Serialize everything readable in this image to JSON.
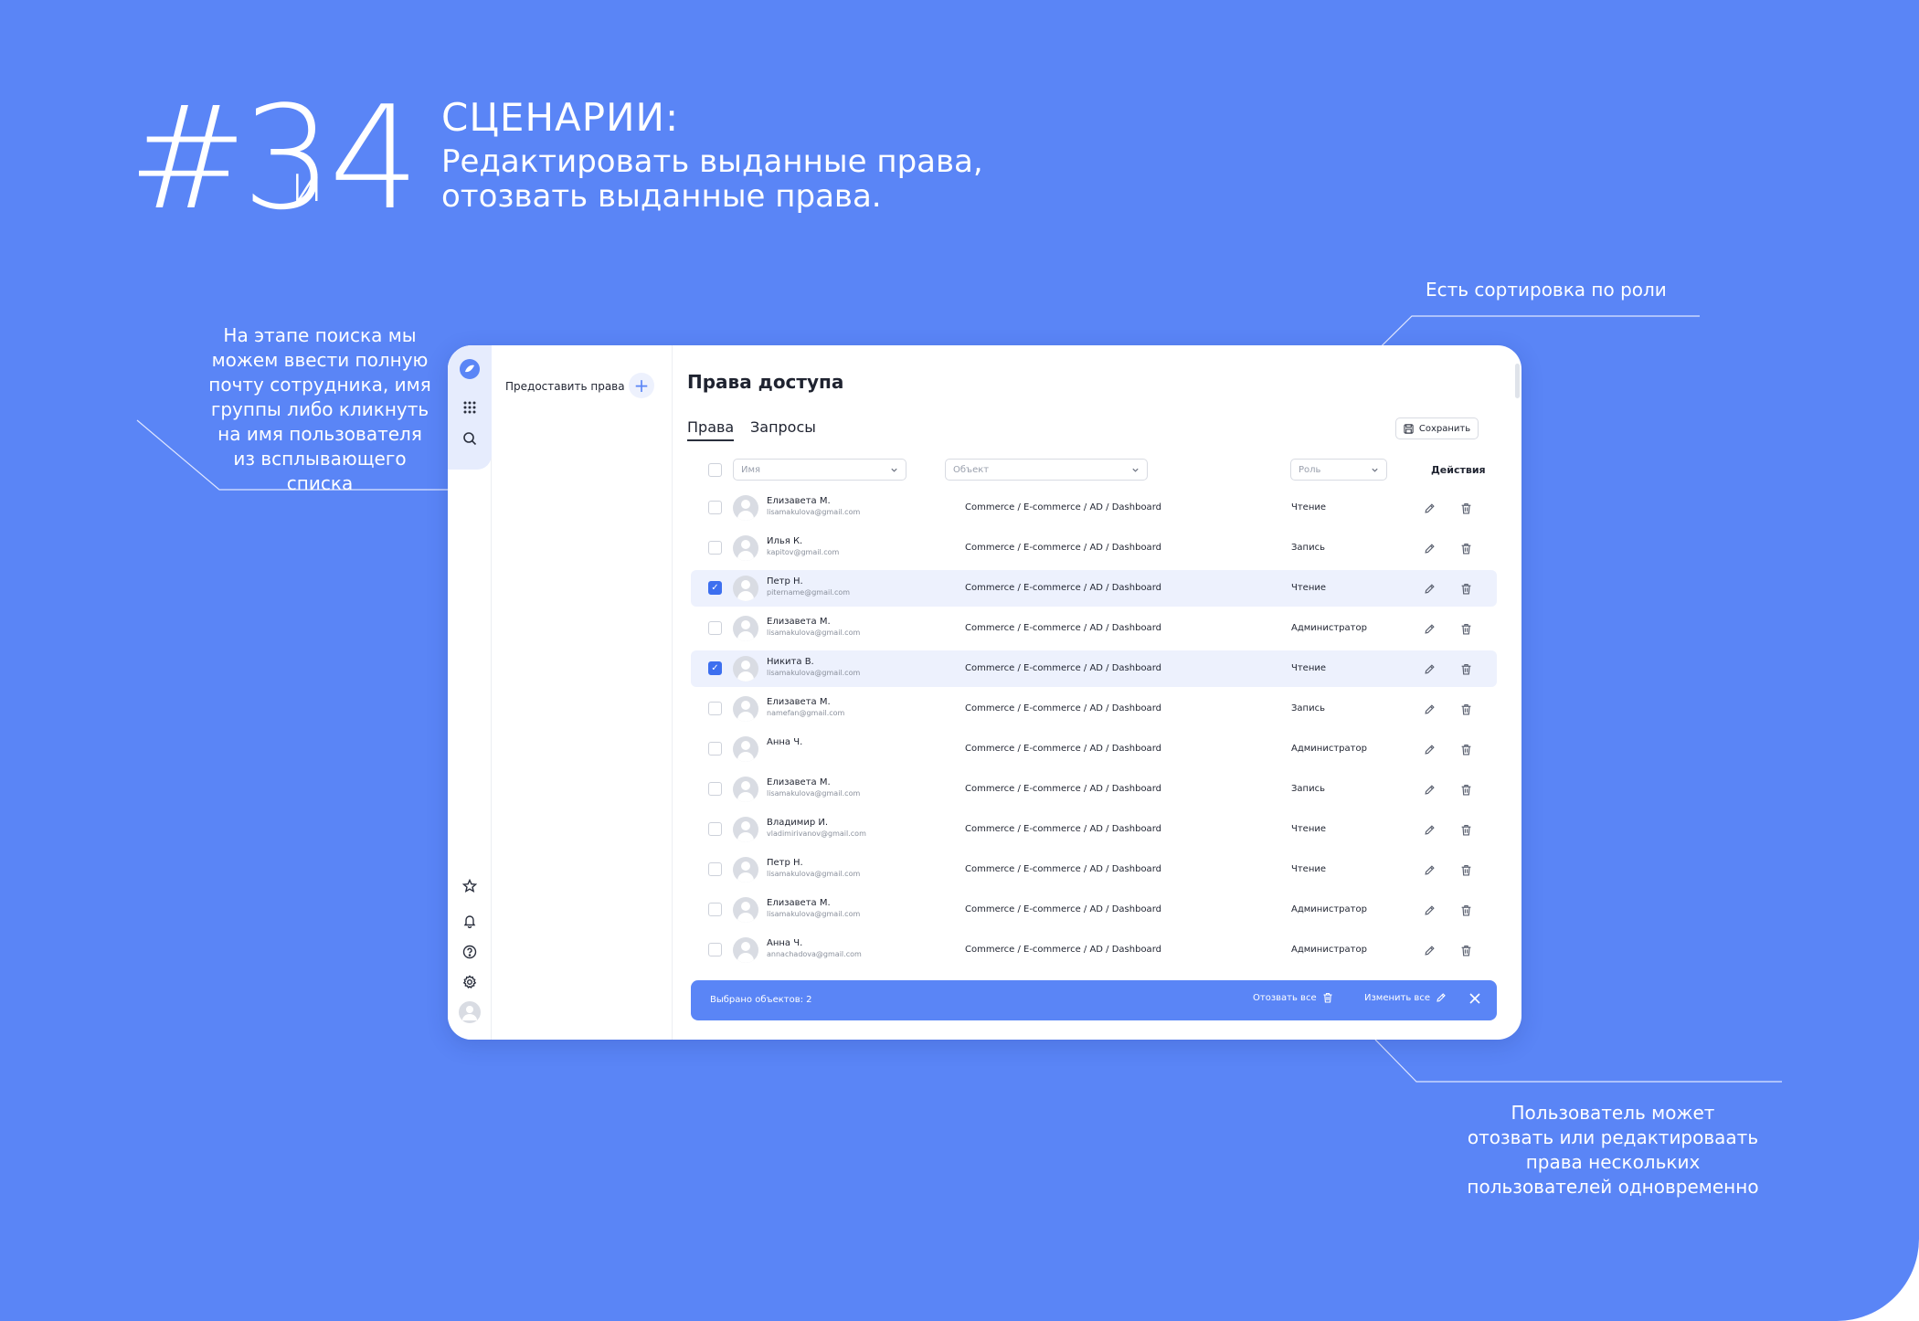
{
  "header": {
    "num_a": "#3",
    "conj": "и",
    "num_b": "4",
    "title": "СЦЕНАРИИ:",
    "subtitle_line1": "Редактировать выданные права,",
    "subtitle_line2": "отозвать выданные права."
  },
  "notes": {
    "search_tip": "На этапе поиска мы можем ввести полную почту сотрудника, имя группы либо кликнуть на имя пользователя из всплывающего списка",
    "sort_tip": "Есть сортировка по роли",
    "bulk_tip": "Пользователь может отозвать или редактироваать права нескольких пользователей одновременно"
  },
  "side_panel": {
    "grant_label": "Предоставить права",
    "grant_button": "+"
  },
  "main": {
    "title": "Права доступа",
    "tabs": [
      "Права",
      "Запросы"
    ],
    "save_label": "Сохранить",
    "filters": {
      "name": "Имя",
      "object": "Объект",
      "role": "Роль"
    },
    "actions_header": "Действия"
  },
  "rows": [
    {
      "name": "Елизавета М.",
      "email": "lisamakulova@gmail.com",
      "object": "Commerce / E-commerce / AD / Dashboard",
      "role": "Чтение",
      "selected": false
    },
    {
      "name": "Илья К.",
      "email": "kapitov@gmail.com",
      "object": "Commerce / E-commerce / AD / Dashboard",
      "role": "Запись",
      "selected": false
    },
    {
      "name": "Петр Н.",
      "email": "pitername@gmail.com",
      "object": "Commerce / E-commerce / AD / Dashboard",
      "role": "Чтение",
      "selected": true
    },
    {
      "name": "Елизавета М.",
      "email": "lisamakulova@gmail.com",
      "object": "Commerce / E-commerce / AD / Dashboard",
      "role": "Администратор",
      "selected": false
    },
    {
      "name": "Никита В.",
      "email": "lisamakulova@gmail.com",
      "object": "Commerce / E-commerce / AD / Dashboard",
      "role": "Чтение",
      "selected": true
    },
    {
      "name": "Елизавета М.",
      "email": "namefan@gmail.com",
      "object": "Commerce / E-commerce / AD / Dashboard",
      "role": "Запись",
      "selected": false
    },
    {
      "name": "Анна Ч.",
      "email": "",
      "object": "Commerce / E-commerce / AD / Dashboard",
      "role": "Администратор",
      "selected": false
    },
    {
      "name": "Елизавета М.",
      "email": "lisamakulova@gmail.com",
      "object": "Commerce / E-commerce / AD / Dashboard",
      "role": "Запись",
      "selected": false
    },
    {
      "name": "Владимир И.",
      "email": "vladimirivanov@gmail.com",
      "object": "Commerce / E-commerce / AD / Dashboard",
      "role": "Чтение",
      "selected": false
    },
    {
      "name": "Петр Н.",
      "email": "lisamakulova@gmail.com",
      "object": "Commerce / E-commerce / AD / Dashboard",
      "role": "Чтение",
      "selected": false
    },
    {
      "name": "Елизавета М.",
      "email": "lisamakulova@gmail.com",
      "object": "Commerce / E-commerce / AD / Dashboard",
      "role": "Администратор",
      "selected": false
    },
    {
      "name": "Анна Ч.",
      "email": "annachadova@gmail.com",
      "object": "Commerce / E-commerce / AD / Dashboard",
      "role": "Администратор",
      "selected": false
    }
  ],
  "bulk_bar": {
    "count_label": "Выбрано объектов: 2",
    "revoke_label": "Отозвать все",
    "edit_label": "Изменить все"
  },
  "icons": {
    "rail": [
      "logo-icon",
      "apps-icon",
      "search-icon",
      "star-icon",
      "bell-icon",
      "help-icon",
      "gear-icon",
      "avatar"
    ],
    "row_actions": [
      "edit-icon",
      "trash-icon"
    ]
  },
  "colors": {
    "background": "#5a85f6",
    "accent": "#3d6fef",
    "selected_row": "#edf1fd",
    "surface": "#ffffff"
  }
}
